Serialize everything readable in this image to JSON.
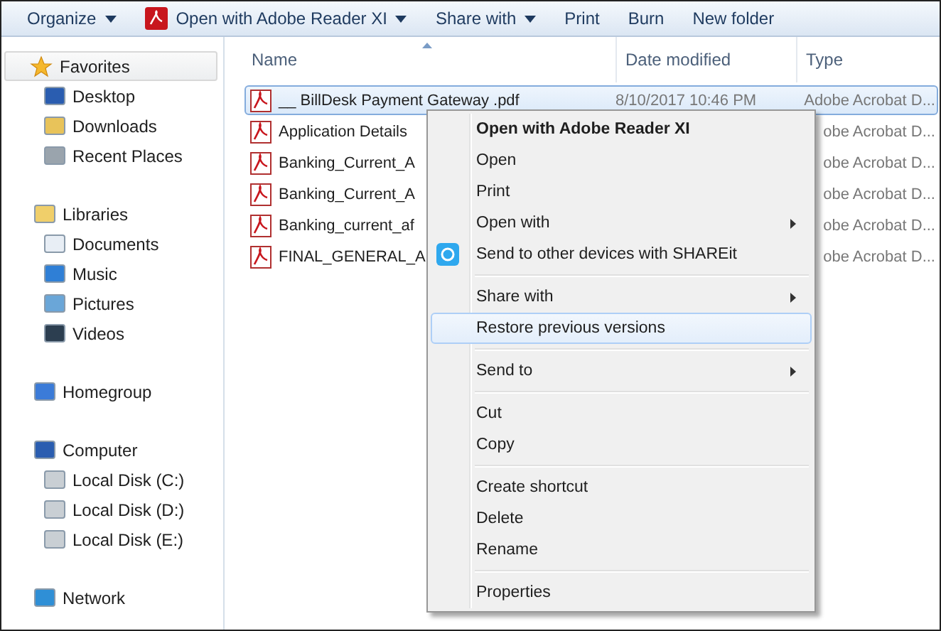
{
  "toolbar": [
    {
      "label": "Organize",
      "kind": "dropdown"
    },
    {
      "label": "Open with Adobe Reader XI",
      "kind": "pdf-dropdown"
    },
    {
      "label": "Share with",
      "kind": "dropdown"
    },
    {
      "label": "Print",
      "kind": "plain"
    },
    {
      "label": "Burn",
      "kind": "plain"
    },
    {
      "label": "New folder",
      "kind": "plain"
    }
  ],
  "sidebar": {
    "groups": [
      {
        "label": "Favorites",
        "selected": true,
        "children": [
          {
            "label": "Desktop"
          },
          {
            "label": "Downloads"
          },
          {
            "label": "Recent Places"
          }
        ]
      },
      {
        "label": "Libraries",
        "selected": false,
        "children": [
          {
            "label": "Documents"
          },
          {
            "label": "Music"
          },
          {
            "label": "Pictures"
          },
          {
            "label": "Videos"
          }
        ]
      },
      {
        "label": "Homegroup",
        "selected": false
      },
      {
        "label": "Computer",
        "selected": false,
        "children": [
          {
            "label": "Local Disk (C:)"
          },
          {
            "label": "Local Disk (D:)"
          },
          {
            "label": "Local Disk (E:)"
          }
        ]
      },
      {
        "label": "Network",
        "selected": false
      }
    ]
  },
  "table": {
    "columns": [
      "Name",
      "Date modified",
      "Type"
    ],
    "rows": [
      {
        "name": "__ BillDesk Payment Gateway .pdf",
        "date": "8/10/2017 10:46 PM",
        "type": "Adobe Acrobat D...",
        "selected": true
      },
      {
        "name": "Application Details",
        "type": "obe Acrobat D...",
        "selected": false
      },
      {
        "name": "Banking_Current_A",
        "type": "obe Acrobat D...",
        "selected": false
      },
      {
        "name": "Banking_Current_A",
        "type": "obe Acrobat D...",
        "selected": false
      },
      {
        "name": "Banking_current_af",
        "type": "obe Acrobat D...",
        "selected": false
      },
      {
        "name": "FINAL_GENERAL_A",
        "type": "obe Acrobat D...",
        "selected": false
      }
    ]
  },
  "context_menu": [
    {
      "kind": "item",
      "label": "Open with Adobe Reader XI",
      "default": true,
      "submenu": false,
      "selected": false
    },
    {
      "kind": "item",
      "label": "Open",
      "default": false,
      "submenu": false,
      "selected": false
    },
    {
      "kind": "item",
      "label": "Print",
      "default": false,
      "submenu": false,
      "selected": false
    },
    {
      "kind": "item",
      "label": "Open with",
      "default": false,
      "submenu": true,
      "selected": false
    },
    {
      "kind": "app",
      "label": "Send to other devices with SHAREit",
      "default": false,
      "submenu": false,
      "selected": false
    },
    {
      "kind": "separator"
    },
    {
      "kind": "item",
      "label": "Share with",
      "default": false,
      "submenu": true,
      "selected": false
    },
    {
      "kind": "item",
      "label": "Restore previous versions",
      "default": false,
      "submenu": false,
      "selected": true
    },
    {
      "kind": "separator"
    },
    {
      "kind": "item",
      "label": "Send to",
      "default": false,
      "submenu": true,
      "selected": false
    },
    {
      "kind": "separator"
    },
    {
      "kind": "item",
      "label": "Cut",
      "default": false,
      "submenu": false,
      "selected": false
    },
    {
      "kind": "item",
      "label": "Copy",
      "default": false,
      "submenu": false,
      "selected": false
    },
    {
      "kind": "separator"
    },
    {
      "kind": "item",
      "label": "Create shortcut",
      "default": false,
      "submenu": false,
      "selected": false
    },
    {
      "kind": "item",
      "label": "Delete",
      "default": false,
      "submenu": false,
      "selected": false
    },
    {
      "kind": "item",
      "label": "Rename",
      "default": false,
      "submenu": false,
      "selected": false
    },
    {
      "kind": "separator"
    },
    {
      "kind": "item",
      "label": "Properties",
      "default": false,
      "submenu": false,
      "selected": false
    }
  ]
}
